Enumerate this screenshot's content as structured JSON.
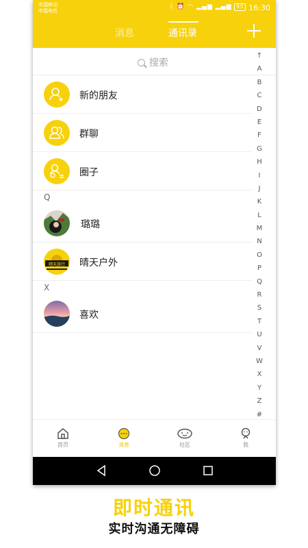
{
  "status_bar": {
    "carrier_1": "中国移动",
    "carrier_2": "中国电信",
    "battery": "95",
    "time": "16:30"
  },
  "header": {
    "tabs": [
      {
        "label": "消息",
        "active": false
      },
      {
        "label": "通讯录",
        "active": true
      }
    ],
    "add_icon": "plus-icon"
  },
  "search": {
    "placeholder": "搜索"
  },
  "contacts": {
    "fixed_items": [
      {
        "label": "新的朋友",
        "icon": "add-friend-icon"
      },
      {
        "label": "群聊",
        "icon": "group-chat-icon"
      },
      {
        "label": "圈子",
        "icon": "circle-icon"
      }
    ],
    "sections": [
      {
        "letter": "Q",
        "items": [
          {
            "name": "璐璐"
          },
          {
            "name": "晴天户外",
            "avatar_text": "晴天旅行"
          }
        ]
      },
      {
        "letter": "X",
        "items": [
          {
            "name": "喜欢"
          }
        ]
      }
    ]
  },
  "index_bar": [
    "↑",
    "A",
    "B",
    "C",
    "D",
    "E",
    "F",
    "G",
    "H",
    "I",
    "J",
    "K",
    "L",
    "M",
    "N",
    "O",
    "P",
    "Q",
    "R",
    "S",
    "T",
    "U",
    "V",
    "W",
    "X",
    "Y",
    "Z",
    "#"
  ],
  "bottom_nav": [
    {
      "label": "首页",
      "icon": "home-icon",
      "active": false
    },
    {
      "label": "消息",
      "icon": "message-icon",
      "active": true
    },
    {
      "label": "社区",
      "icon": "community-icon",
      "active": false
    },
    {
      "label": "我",
      "icon": "profile-icon",
      "active": false
    }
  ],
  "caption": {
    "title": "即时通讯",
    "subtitle": "实时沟通无障碍"
  },
  "colors": {
    "accent": "#f7d10c",
    "active_nav": "#f0c400"
  }
}
